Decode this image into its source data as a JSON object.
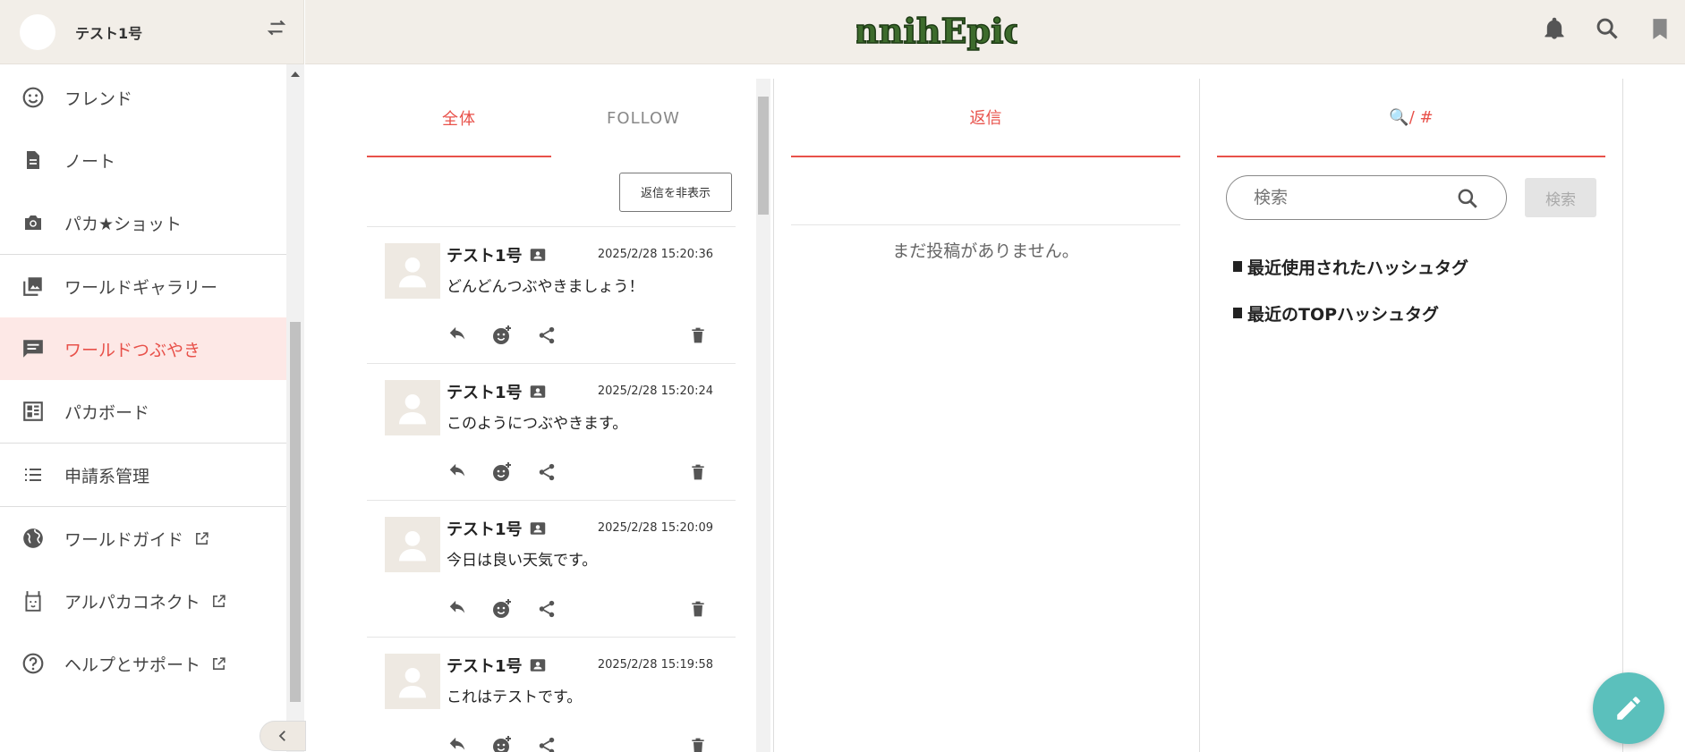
{
  "user": {
    "name": "テスト1号"
  },
  "brand": {
    "logo_text": "AnnihEpica"
  },
  "sidebar": {
    "groups": [
      [
        {
          "label": "フレンド",
          "icon": "smile-icon"
        },
        {
          "label": "ノート",
          "icon": "note-icon"
        },
        {
          "label": "パカ★ショット",
          "icon": "camera-icon"
        }
      ],
      [
        {
          "label": "ワールドギャラリー",
          "icon": "gallery-icon"
        },
        {
          "label": "ワールドつぶやき",
          "icon": "chat-icon",
          "active": true
        },
        {
          "label": "パカボード",
          "icon": "board-icon"
        }
      ],
      [
        {
          "label": "申請系管理",
          "icon": "list-icon"
        }
      ],
      [
        {
          "label": "ワールドガイド",
          "icon": "globe-icon",
          "external": true
        },
        {
          "label": "アルパカコネクト",
          "icon": "alpaca-icon",
          "external": true
        },
        {
          "label": "ヘルプとサポート",
          "icon": "help-icon",
          "external": true
        }
      ]
    ]
  },
  "timeline": {
    "tabs": [
      {
        "label": "全体",
        "active": true
      },
      {
        "label": "FOLLOW",
        "active": false
      }
    ],
    "hide_replies_label": "返信を非表示",
    "posts": [
      {
        "name": "テスト1号",
        "time": "2025/2/28 15:20:36",
        "text": "どんどんつぶやきましょう！"
      },
      {
        "name": "テスト1号",
        "time": "2025/2/28 15:20:24",
        "text": "このようにつぶやきます。"
      },
      {
        "name": "テスト1号",
        "time": "2025/2/28 15:20:09",
        "text": "今日は良い天気です。"
      },
      {
        "name": "テスト1号",
        "time": "2025/2/28 15:19:58",
        "text": "これはテストです。"
      }
    ]
  },
  "replies": {
    "tab_label": "返信",
    "empty_message": "まだ投稿がありません。"
  },
  "search": {
    "tab_label": "🔍/ #",
    "placeholder": "検索",
    "button_label": "検索",
    "recent_hashtags_label": "最近使用されたハッシュタグ",
    "top_hashtags_label": "最近のTOPハッシュタグ"
  },
  "colors": {
    "accent": "#e8514a",
    "fab": "#5bc0bc",
    "header_bg": "#f2eee8"
  }
}
